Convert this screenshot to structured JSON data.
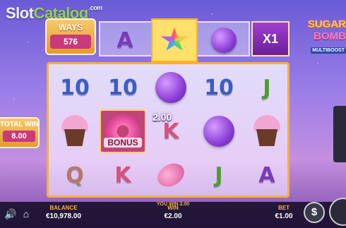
{
  "watermark": {
    "slot": "Slot",
    "catalog": "Catalog",
    "dotcom": ".com"
  },
  "ways": {
    "label": "WAYS",
    "count": "576"
  },
  "multiplier": "X1",
  "logo": {
    "line1": "SUGAR",
    "line2": "BOMB",
    "line3": "MULTIBOOST"
  },
  "total_win": {
    "label": "TOTAL WIN",
    "value": "8.00"
  },
  "win_popup": "2.00",
  "top_reel": [
    {
      "kind": "letter",
      "value": "A",
      "color": "#7a3bb8"
    },
    {
      "kind": "icon",
      "icon": "star-candy-icon"
    },
    {
      "kind": "icon",
      "icon": "round-candy-icon"
    }
  ],
  "grid": [
    [
      {
        "kind": "letter",
        "value": "10",
        "color": "#3b5ec4"
      },
      {
        "kind": "letter",
        "value": "10",
        "color": "#3b5ec4"
      },
      {
        "kind": "icon",
        "icon": "round-candy-icon"
      },
      {
        "kind": "letter",
        "value": "10",
        "color": "#3b5ec4"
      },
      {
        "kind": "letter",
        "value": "J",
        "color": "#4c9c2e"
      }
    ],
    [
      {
        "kind": "icon",
        "icon": "cupcake-icon"
      },
      {
        "kind": "bonus",
        "icon": "donut-icon",
        "label": "BONUS"
      },
      {
        "kind": "letter",
        "value": "K",
        "color": "#d4527e"
      },
      {
        "kind": "icon",
        "icon": "round-candy-icon"
      },
      {
        "kind": "icon",
        "icon": "cupcake-icon"
      }
    ],
    [
      {
        "kind": "letter",
        "value": "Q",
        "color": "#b37a6a"
      },
      {
        "kind": "letter",
        "value": "K",
        "color": "#d4527e"
      },
      {
        "kind": "icon",
        "icon": "wrapped-candy-icon"
      },
      {
        "kind": "letter",
        "value": "J",
        "color": "#4c9c2e"
      },
      {
        "kind": "letter",
        "value": "A",
        "color": "#7a3bb8"
      }
    ]
  ],
  "bottom": {
    "balance_label": "BALANCE",
    "balance_value": "€10,978.00",
    "you_win": "YOU WIN 2.00",
    "win_label": "WIN",
    "win_value": "€2.00",
    "bet_label": "BET",
    "bet_value": "€1.00",
    "coin_symbol": "$"
  }
}
